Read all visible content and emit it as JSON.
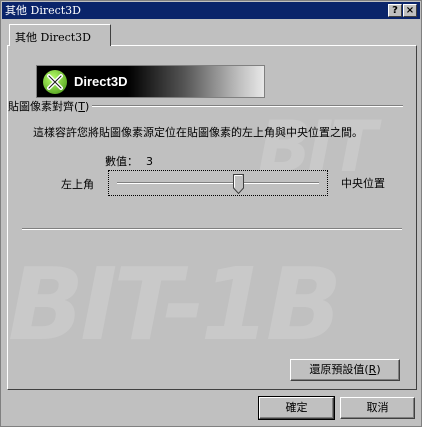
{
  "window": {
    "title": "其他 Direct3D",
    "help_button": "?",
    "close_button": "×"
  },
  "tabs": [
    {
      "label": "其他 Direct3D",
      "selected": true
    }
  ],
  "banner": {
    "logo_icon": "directx-x-logo",
    "text": "Direct3D"
  },
  "group": {
    "label": "貼圖像素對齊",
    "mnemonic": "T",
    "description": "這樣容許您將貼圖像素源定位在貼圖像素的左上角與中央位置之間。",
    "value_label": "數值：",
    "value": "3",
    "slider": {
      "left_label": "左上角",
      "right_label": "中央位置",
      "position_fraction": 0.6
    }
  },
  "buttons": {
    "restore_default": "還原預設值",
    "restore_mnemonic": "R",
    "ok": "確定",
    "cancel": "取消"
  },
  "watermark": {
    "top_text": "BIT",
    "bottom_text": "BIT-1B"
  },
  "colors": {
    "titlebar": "#0a246a",
    "face": "#c0c0c0",
    "logo_green": "#5cc21c"
  }
}
